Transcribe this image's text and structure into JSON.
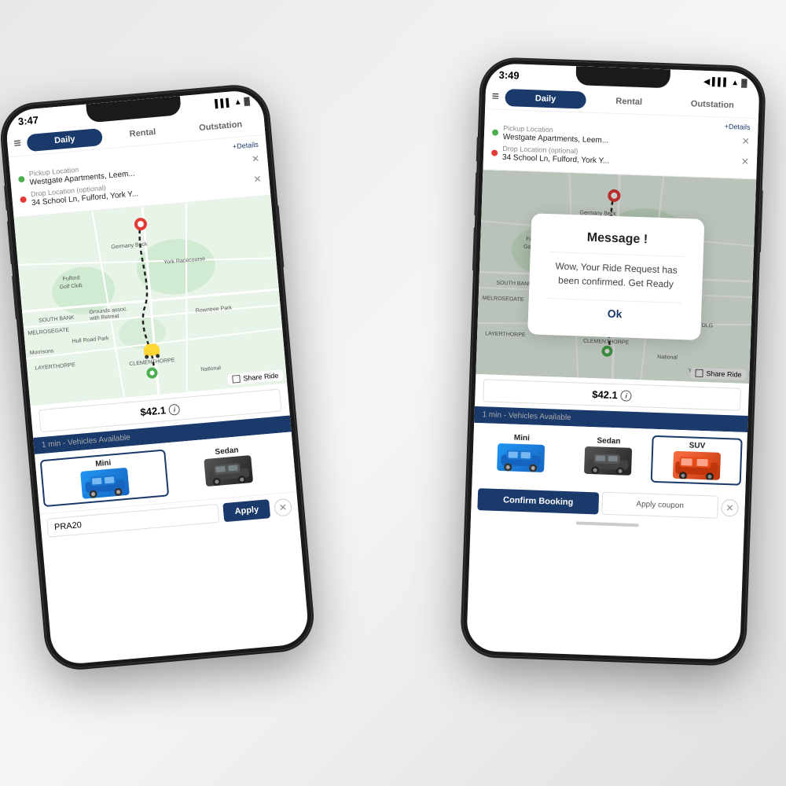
{
  "scene": {
    "background": "#efefef"
  },
  "phone1": {
    "status": {
      "time": "3:47",
      "icons": "●●● ▲ 🔋"
    },
    "tabs": {
      "items": [
        "Daily",
        "Rental",
        "Outstation"
      ],
      "active": "Daily"
    },
    "pickup": {
      "label": "Pickup Location",
      "value": "Westgate Apartments, Leem...",
      "details_link": "+Details"
    },
    "drop": {
      "label": "Drop Location (optional)",
      "value": "34 School Ln, Fulford, York Y..."
    },
    "price": "$42.1",
    "share_ride_label": "Share Ride",
    "vehicles_label": "1 min",
    "vehicles_sublabel": " - Vehicles Available",
    "vehicles": [
      {
        "name": "Mini",
        "type": "mini"
      },
      {
        "name": "Sedan",
        "type": "sedan"
      }
    ],
    "coupon": {
      "placeholder": "PRA20",
      "apply_label": "Apply"
    }
  },
  "phone2": {
    "status": {
      "time": "3:49",
      "icons": "●●● ▲ 🔋"
    },
    "tabs": {
      "items": [
        "Daily",
        "Rental",
        "Outstation"
      ],
      "active": "Daily"
    },
    "pickup": {
      "label": "Pickup Location",
      "value": "Westgate Apartments, Leem...",
      "details_link": "+Details"
    },
    "drop": {
      "label": "Drop Location (optional)",
      "value": "34 School Ln, Fulford, York Y..."
    },
    "price": "$42.1",
    "share_ride_label": "Share Ride",
    "vehicles_label": "1 min",
    "vehicles_sublabel": " - Vehicles Available",
    "vehicles": [
      {
        "name": "Mini",
        "type": "mini"
      },
      {
        "name": "Sedan",
        "type": "sedan"
      },
      {
        "name": "SUV",
        "type": "suv",
        "selected": true
      }
    ],
    "confirm_btn": "Confirm Booking",
    "coupon_btn": "Apply coupon",
    "dialog": {
      "title": "Message !",
      "body": "Wow, Your Ride Request has been confirmed. Get Ready",
      "ok_label": "Ok"
    }
  }
}
